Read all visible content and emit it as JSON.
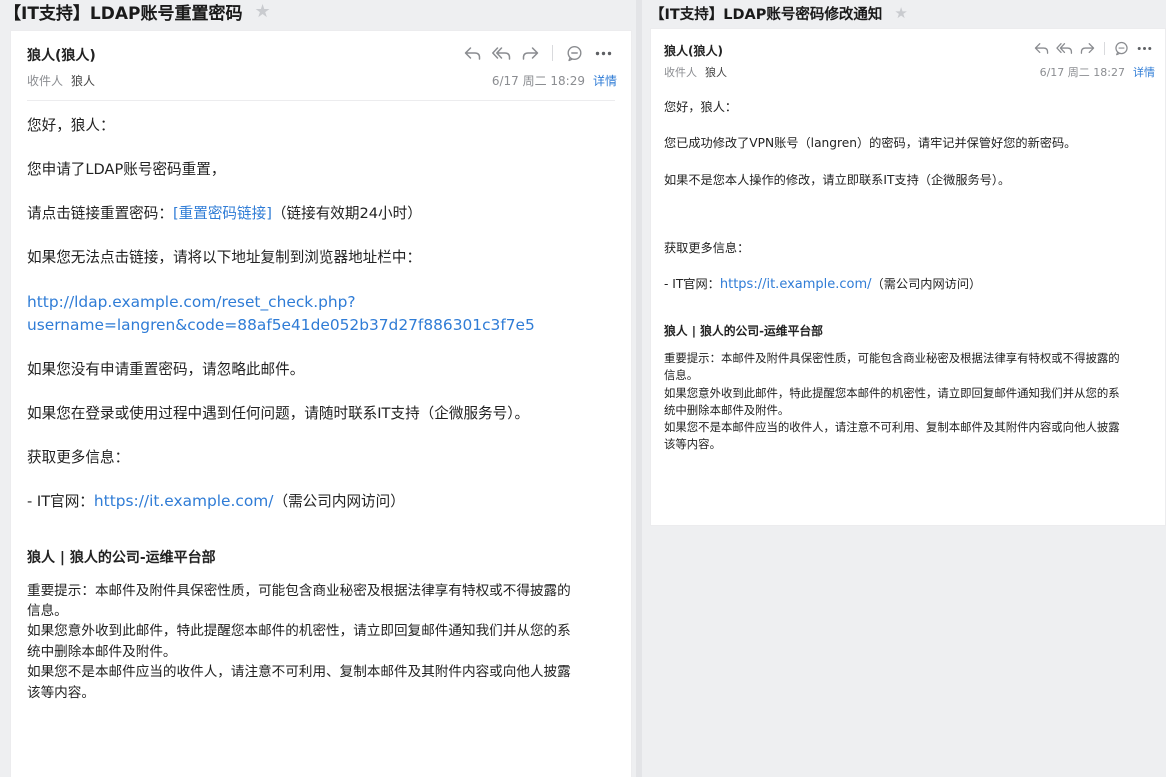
{
  "left": {
    "subject": "【IT支持】LDAP账号重置密码",
    "star": "★",
    "sender": "狼人(狼人)",
    "to_label": "收件人",
    "to_name": "狼人",
    "date": "6/17 周二 18:29",
    "detail_link": "详情",
    "toolbar_icons": [
      "reply-icon",
      "reply-all-icon",
      "forward-icon",
      "comment-icon",
      "more-icon"
    ],
    "body": {
      "greeting": "您好，狼人：",
      "requested": "您申请了LDAP账号密码重置，",
      "click_prefix": "请点击链接重置密码：",
      "reset_link": "[重置密码链接]",
      "click_suffix": "（链接有效期24小时）",
      "copy_hint": "如果您无法点击链接，请将以下地址复制到浏览器地址栏中：",
      "url_line1": "http://ldap.example.com/reset_check.php?",
      "url_line2": "username=langren&code=88af5e41de052b37d27f886301c3f7e5",
      "ignore": "如果您没有申请重置密码，请忽略此邮件。",
      "contact": "如果您在登录或使用过程中遇到任何问题，请随时联系IT支持（企微服务号）。",
      "more_info": "获取更多信息：",
      "site_prefix": "- IT官网：",
      "site_link": "https://it.example.com/",
      "site_suffix": "（需公司内网访问）",
      "signature": "狼人 | 狼人的公司-运维平台部",
      "disclaimer_1a": "重要提示：本邮件及附件具保密性质，可能包含商业秘密及根据法律享有特权或不得披露的",
      "disclaimer_1b": "信息。",
      "disclaimer_2a": "如果您意外收到此邮件，特此提醒您本邮件的机密性，请立即回复邮件通知我们并从您的系",
      "disclaimer_2b": "统中删除本邮件及附件。",
      "disclaimer_3a": "如果您不是本邮件应当的收件人，请注意不可利用、复制本邮件及其附件内容或向他人披露",
      "disclaimer_3b": "该等内容。"
    }
  },
  "right": {
    "subject": "【IT支持】LDAP账号密码修改通知",
    "star": "★",
    "sender": "狼人(狼人)",
    "to_label": "收件人",
    "to_name": "狼人",
    "date": "6/17 周二 18:27",
    "detail_link": "详情",
    "toolbar_icons": [
      "reply-icon",
      "reply-all-icon",
      "forward-icon",
      "comment-icon",
      "more-icon"
    ],
    "body": {
      "greeting": "您好，狼人：",
      "changed": "您已成功修改了VPN账号（langren）的密码，请牢记并保管好您的新密码。",
      "not_you": "如果不是您本人操作的修改，请立即联系IT支持（企微服务号）。",
      "more_info": "获取更多信息：",
      "site_prefix": "- IT官网：",
      "site_link": "https://it.example.com/",
      "site_suffix": "（需公司内网访问）",
      "signature": "狼人 | 狼人的公司-运维平台部",
      "disclaimer_1a": "重要提示：本邮件及附件具保密性质，可能包含商业秘密及根据法律享有特权或不得披露的",
      "disclaimer_1b": "信息。",
      "disclaimer_2a": "如果您意外收到此邮件，特此提醒您本邮件的机密性，请立即回复邮件通知我们并从您的系",
      "disclaimer_2b": "统中删除本邮件及附件。",
      "disclaimer_3a": "如果您不是本邮件应当的收件人，请注意不可利用、复制本邮件及其附件内容或向他人披露",
      "disclaimer_3b": "该等内容。"
    }
  },
  "colors": {
    "link": "#2f7cd6",
    "background": "#eeeff1",
    "card": "#ffffff",
    "muted_text": "#8b8d91",
    "icon": "#8a8c90"
  }
}
